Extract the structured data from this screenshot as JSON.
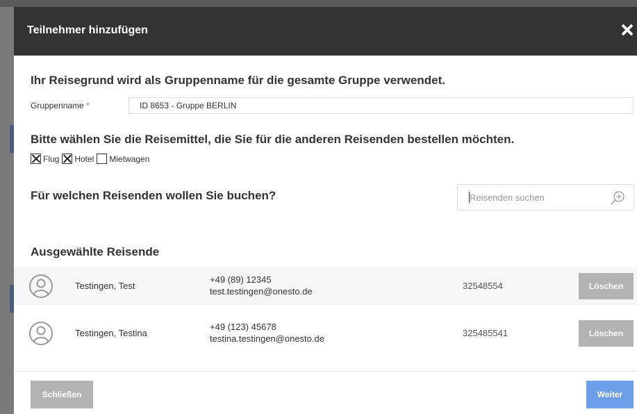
{
  "modal": {
    "title": "Teilnehmer hinzufügen"
  },
  "group": {
    "heading": "Ihr Reisegrund wird als Gruppenname für die gesamte Gruppe verwendet.",
    "label": "Gruppenname",
    "required_mark": "*",
    "value": "ID 8653 - Gruppe BERLIN"
  },
  "travel_means": {
    "heading": "Bitte wählen Sie die Reisemittel, die Sie für die anderen Reisenden bestellen möchten.",
    "options": [
      {
        "label": "Flug",
        "checked": true
      },
      {
        "label": "Hotel",
        "checked": true
      },
      {
        "label": "Mietwagen",
        "checked": false
      }
    ]
  },
  "search": {
    "heading": "Für welchen Reisenden wollen Sie buchen?",
    "placeholder": "Reisenden suchen",
    "icon": "zoom-in-icon"
  },
  "selected": {
    "heading": "Ausgewählte Reisende",
    "travelers": [
      {
        "name": "Testingen, Test",
        "phone": "+49 (89) 12345",
        "email": "test.testingen@onesto.de",
        "number": "32548554",
        "delete_label": "Löschen"
      },
      {
        "name": "Testingen, Testina",
        "phone": "+49 (123) 45678",
        "email": "testina.testingen@onesto.de",
        "number": "325485541",
        "delete_label": "Löschen"
      }
    ]
  },
  "footer": {
    "close_label": "Schließen",
    "next_label": "Weiter"
  },
  "colors": {
    "header_bg": "#333333",
    "primary_button": "#6d9ee8",
    "secondary_button": "#b3b3b3",
    "required": "#4a90e2"
  }
}
